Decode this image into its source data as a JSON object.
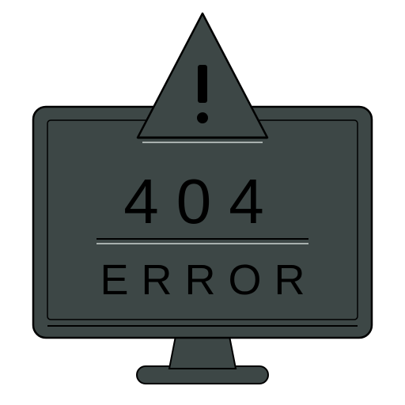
{
  "error": {
    "code": "404",
    "word": "ERROR"
  },
  "colors": {
    "fill": "#3d4746",
    "outline": "#000000",
    "highlight": "#cbd3d1",
    "background": "#ffffff"
  },
  "icons": {
    "warning": "warning-triangle-icon",
    "monitor": "monitor-icon"
  }
}
